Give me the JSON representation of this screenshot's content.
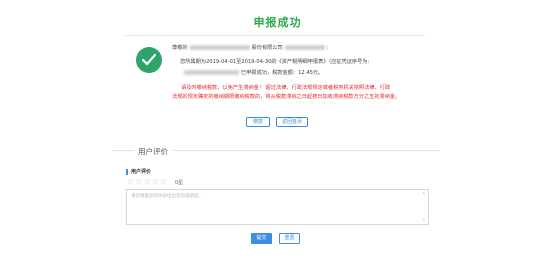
{
  "header": {
    "title": "申报成功"
  },
  "message": {
    "greeting_prefix": "尊敬的",
    "company_suffix": "股份有限公司",
    "line2_prefix": "您所属期为2019-04-01至2019-04-30的《资产税明细申报表》（应征凭证序号为:",
    "line3": "已申报成功，税款金额：12.45元。",
    "warning_line1": "请及时缴纳税款，以免产生滞纳金！ 超过法律、行政法规规定或者税务机关依照法律、行政",
    "warning_line2": "法规的规定确定的缴纳期限缴纳税款的，将从税款滞纳之日起按日加收滞纳税款万分之五的滞纳金。"
  },
  "actions": {
    "pay_label": "缴款",
    "return_label": "返回首页"
  },
  "feedback": {
    "section_title": "用户评价",
    "rating_label": "用户评价",
    "score_text": "0星",
    "comment_placeholder": "请您根据您的体验给出您的满意度…",
    "submit_label": "提交",
    "reset_label": "重置"
  },
  "colors": {
    "success": "#2ea46a",
    "title": "#2aa84a",
    "accent": "#3b8ee0",
    "warning": "#e0252b"
  }
}
